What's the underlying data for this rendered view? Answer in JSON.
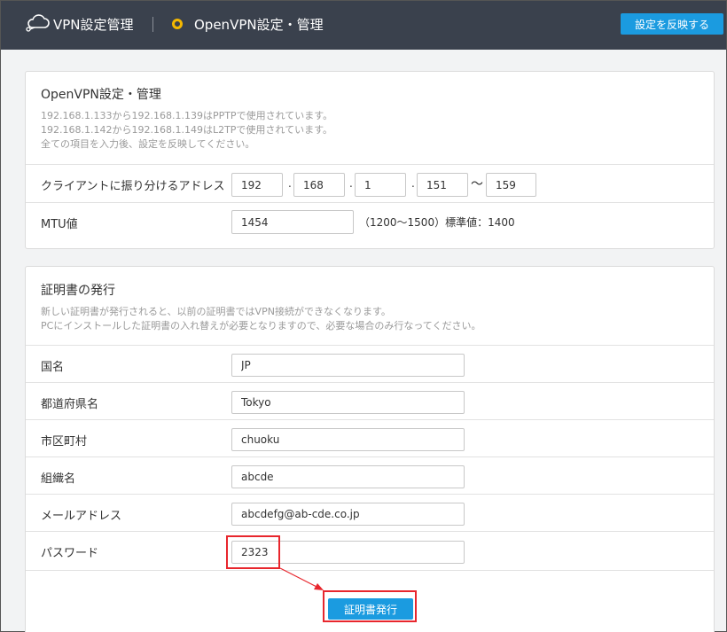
{
  "header": {
    "app_title": "VPN設定管理",
    "page_name": "OpenVPN設定・管理",
    "apply_label": "設定を反映する",
    "colors": {
      "bar": "#3a414d",
      "accent": "#1b9be0",
      "status": "#f5b800"
    },
    "icons": [
      "cloud-network-icon",
      "status-circle-icon"
    ]
  },
  "openvpn": {
    "title": "OpenVPN設定・管理",
    "desc1": "192.168.1.133から192.168.1.139はPPTPで使用されています。",
    "desc2": "192.168.1.142から192.168.1.149はL2TPで使用されています。",
    "desc3": "全ての項目を入力後、設定を反映してください。",
    "client_label": "クライアントに振り分けるアドレス",
    "ip": [
      "192",
      "168",
      "1",
      "151"
    ],
    "dot": ".",
    "tilde": "〜",
    "ip_end": "159",
    "mtu_label": "MTU値",
    "mtu_value": "1454",
    "mtu_hint": "（1200〜1500）標準値：1400"
  },
  "cert": {
    "title": "証明書の発行",
    "desc1": "新しい証明書が発行されると、以前の証明書ではVPN接続ができなくなります。",
    "desc2": "PCにインストールした証明書の入れ替えが必要となりますので、必要な場合のみ行なってください。",
    "fields": [
      {
        "label": "国名",
        "value": "JP"
      },
      {
        "label": "都道府県名",
        "value": "Tokyo"
      },
      {
        "label": "市区町村",
        "value": "chuoku"
      },
      {
        "label": "組織名",
        "value": "abcde"
      },
      {
        "label": "メールアドレス",
        "value": "abcdefg@ab-cde.co.jp"
      },
      {
        "label": "パスワード",
        "value": "2323"
      }
    ],
    "issue_label": "証明書発行",
    "highlight_color": "#e8262d"
  }
}
